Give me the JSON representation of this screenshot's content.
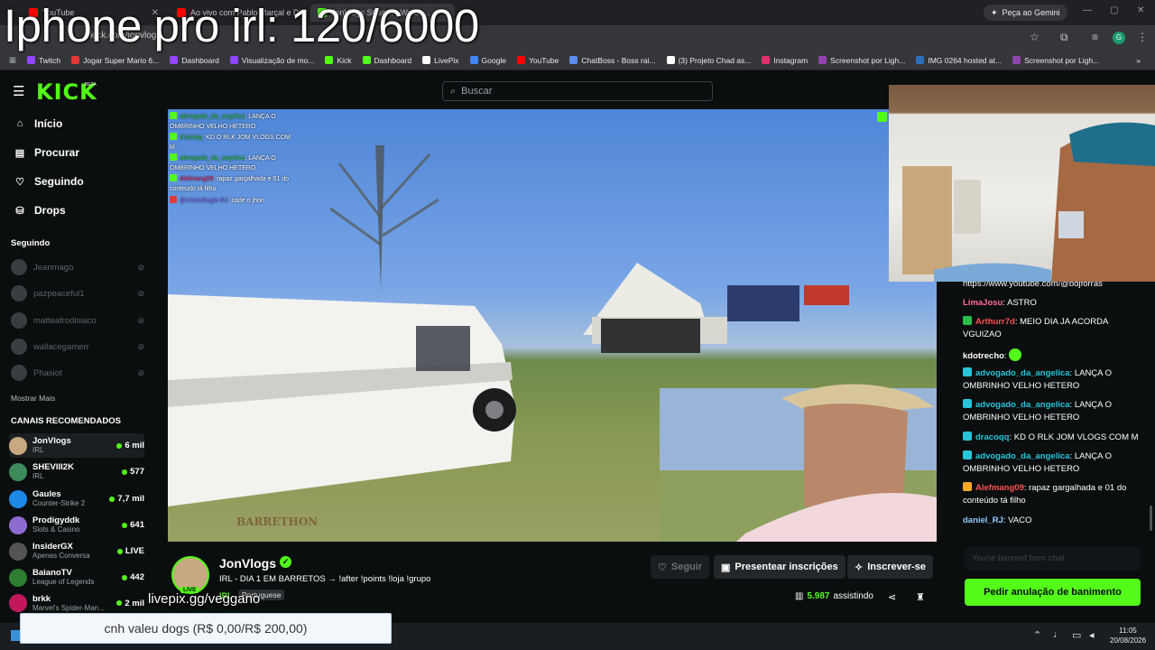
{
  "overlay": {
    "title": "Iphone pro irl: 120/6000",
    "livepix_text": "livepix.gg/veggano",
    "goal_text": "cnh valeu dogs (R$ 0,00/R$ 200,00)"
  },
  "browser": {
    "tabs": [
      {
        "label": "YouTube",
        "color": "#ff0000"
      },
      {
        "label": "Ao vivo com Pablo Marçal e Di...",
        "color": "#ff0000"
      },
      {
        "label": "JonVlogs Stream - Watch...",
        "color": "#53fc18"
      }
    ],
    "gemini_label": "Peça ao Gemini",
    "url": "kick.com/jonvlogs",
    "bookmarks": [
      {
        "label": "Twitch",
        "color": "#9146ff"
      },
      {
        "label": "Jogar Super Mario 6...",
        "color": "#e53935"
      },
      {
        "label": "Dashboard",
        "color": "#9146ff"
      },
      {
        "label": "Visualização de mo...",
        "color": "#9146ff"
      },
      {
        "label": "Kick",
        "color": "#53fc18"
      },
      {
        "label": "Dashboard",
        "color": "#53fc18"
      },
      {
        "label": "LivePix",
        "color": "#ffffff"
      },
      {
        "label": "Google",
        "color": "#4285f4"
      },
      {
        "label": "YouTube",
        "color": "#ff0000"
      },
      {
        "label": "ChatBoss - Boss rai...",
        "color": "#5b8def"
      },
      {
        "label": "(3) Projeto Chad as...",
        "color": "#ffffff"
      },
      {
        "label": "Instagram",
        "color": "#e1306c"
      },
      {
        "label": "Screenshot por Ligh...",
        "color": "#8e44ad"
      },
      {
        "label": "IMG 0264 hosted at...",
        "color": "#2c6fbf"
      },
      {
        "label": "Screenshot por Ligh...",
        "color": "#8e44ad"
      }
    ]
  },
  "header": {
    "logo": "KICK",
    "logo_badge": "BETA",
    "search_placeholder": "Buscar"
  },
  "sidebar": {
    "nav": [
      {
        "label": "Início",
        "icon": "home-icon"
      },
      {
        "label": "Procurar",
        "icon": "browse-icon"
      },
      {
        "label": "Seguindo",
        "icon": "heart-icon"
      },
      {
        "label": "Drops",
        "icon": "drops-icon"
      }
    ],
    "following_title": "Seguindo",
    "following": [
      "Jeanmago",
      "pazpeaceful1",
      "matteafrodisiaco",
      "wallacegamerr",
      "Phasiot"
    ],
    "show_more": "Mostrar Mais",
    "recommended_title": "CANAIS RECOMENDADOS",
    "recommended": [
      {
        "name": "JonVlogs",
        "category": "IRL",
        "viewers": "6 mil",
        "color": "#c8a882"
      },
      {
        "name": "SHEVIII2K",
        "category": "IRL",
        "viewers": "577",
        "color": "#3d8b5a"
      },
      {
        "name": "Gaules",
        "category": "Counter-Strike 2",
        "viewers": "7,7 mil",
        "color": "#1e88e5"
      },
      {
        "name": "Prodigyddk",
        "category": "Slots & Casino",
        "viewers": "641",
        "color": "#8e6bd1"
      },
      {
        "name": "InsiderGX",
        "category": "Apenas Conversa",
        "viewers": "LIVE",
        "color": "#555555"
      },
      {
        "name": "BaianoTV",
        "category": "League of Legends",
        "viewers": "442",
        "color": "#2e7d32"
      },
      {
        "name": "brkk",
        "category": "Marvel's Spider-Man...",
        "viewers": "2 mil",
        "color": "#c2185b"
      }
    ]
  },
  "video_chat": [
    {
      "user": "advogado_da_angelica",
      "text": ": LANÇA O",
      "color": "#2bbf4a"
    },
    {
      "user": "",
      "text": "OMBRINHO VELHO HETERO",
      "color": "#2bbf4a"
    },
    {
      "user": "dracoqq",
      "text": ": KD O RLK JOM VLOGS COM",
      "color": "#2bbf4a"
    },
    {
      "user": "",
      "text": "M",
      "color": "#2bbf4a"
    },
    {
      "user": "advogado_da_angelica",
      "text": ": LANÇA O",
      "color": "#2bbf4a"
    },
    {
      "user": "",
      "text": "OMBRINHO VELHO HETERO",
      "color": "#2bbf4a"
    },
    {
      "user": "Alefmang09",
      "text": ": rapaz gargalhada e 01 do",
      "color": "#e0245e"
    },
    {
      "user": "",
      "text": "conteudo tá filho",
      "color": "#e0245e"
    },
    {
      "user": "@VictorEagle-RJ",
      "text": ": cade o jhon",
      "color": "#7b68ee"
    }
  ],
  "video_watermark": "BARRETHON",
  "channel": {
    "name": "JonVlogs",
    "live_badge": "LIVE",
    "title": "IRL - DIA 1 EM BARRETOS → !after !points !loja !grupo",
    "category": "IRL",
    "language": "Portuguese",
    "follow_label": "Seguir",
    "gift_label": "Presentear inscrições",
    "subscribe_label": "Inscrever-se",
    "viewers": "5.987",
    "viewers_suffix": "assistindo"
  },
  "chat": {
    "messages": [
      {
        "user": "",
        "text": "https://www.youtube.com/@bdjforras",
        "color": "#ffffff",
        "badge": false
      },
      {
        "user": "LimaJosu",
        "text": ": ASTRO",
        "color": "#ff6b9d",
        "badge": false
      },
      {
        "user": "Arthurr7d",
        "text": ": MEIO DIA JA ACORDA VGUIZAO",
        "color": "#ff5252",
        "badge": true
      },
      {
        "user": "kdotrecho",
        "text": ":",
        "color": "#ffffff",
        "badge": false
      },
      {
        "user": "advogado_da_angelica",
        "text": ": LANÇA O OMBRINHO VELHO HETERO",
        "color": "#26c6da",
        "badge": true
      },
      {
        "user": "advogado_da_angelica",
        "text": ": LANÇA O OMBRINHO VELHO HETERO",
        "color": "#26c6da",
        "badge": true
      },
      {
        "user": "dracoqq",
        "text": ": KD O RLK JOM VLOGS COM M",
        "color": "#26c6da",
        "badge": true
      },
      {
        "user": "advogado_da_angelica",
        "text": ": LANÇA O OMBRINHO VELHO HETERO",
        "color": "#26c6da",
        "badge": true
      },
      {
        "user": "Alefmang09",
        "text": ": rapaz gargalhada e 01 do conteúdo tá filho",
        "color": "#ff5252",
        "badge": true
      },
      {
        "user": "daniel_RJ",
        "text": ": VACO",
        "color": "#90caf9",
        "badge": false
      }
    ],
    "input_placeholder": "You're banned from chat",
    "unban_label": "Pedir anulação de banimento"
  },
  "taskbar": {
    "time": "11:05",
    "date": "20/08/2026"
  }
}
